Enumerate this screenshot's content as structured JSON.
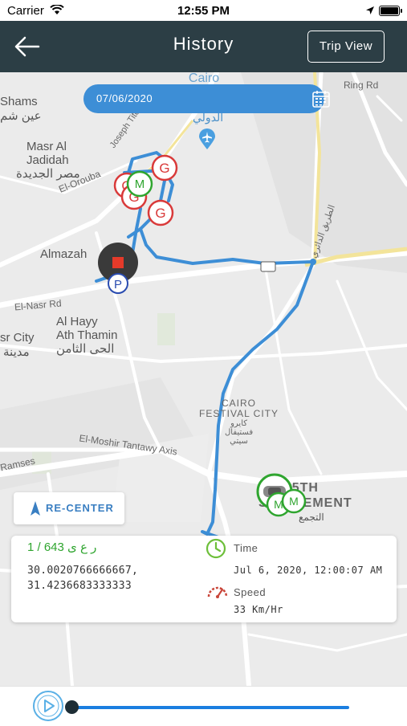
{
  "status_bar": {
    "carrier": "Carrier",
    "time": "12:55 PM"
  },
  "header": {
    "title": "History",
    "trip_view_label": "Trip View"
  },
  "date_picker": {
    "date": "07/06/2020"
  },
  "map": {
    "labels": {
      "shams": "Shams",
      "shams_ar": "عين شم",
      "masr_al_jadidah": "Masr Al\nJadidah",
      "masr_al_jadidah_ar": "مصر الجديدة",
      "almazah": "Almazah",
      "el_nasr_rd": "El-Nasr Rd",
      "al_hayy": "Al Hayy\nAth Thamin",
      "al_hayy_ar": "الحى الثامن",
      "sr_city": "sr City",
      "sr_city_ar": "مدينة",
      "cairo_airport": "Cairo\nInternational\nAirport",
      "airport_ar": "الدولي",
      "ring_rd": "Ring Rd",
      "el_orouba": "El-Orouba",
      "joseph_tito": "Joseph Tito",
      "cairo_festival_city": "CAIRO\nFESTIVAL CITY",
      "festival_ar": "كايرو\nفستيفال\nسيتي",
      "tantawy_axis": "El-Moshir Tantawy Axis",
      "ramses": "Ramses",
      "fifth_settlement": "5TH\nSETTLEMENT",
      "fifth_ar": "التجمع",
      "ring_road_ar": "الطريق الدائري"
    },
    "markers": [
      "G",
      "G",
      "G",
      "G",
      "M",
      "M",
      "M",
      "P"
    ]
  },
  "recenter_label": "RE-CENTER",
  "info_card": {
    "plate": "1 / 643 ر ع ى",
    "latitude": "30.0020766666667,",
    "longitude": "31.4236683333333",
    "time_label": "Time",
    "time_value": "Jul 6, 2020, 12:00:07 AM",
    "speed_label": "Speed",
    "speed_value": "33 Km/Hr"
  },
  "colors": {
    "appbar": "#2c3e45",
    "route": "#3d8ed6",
    "accent_green": "#2fa52f",
    "marker_red": "#d93a3a"
  },
  "player": {
    "progress": 0.0
  }
}
